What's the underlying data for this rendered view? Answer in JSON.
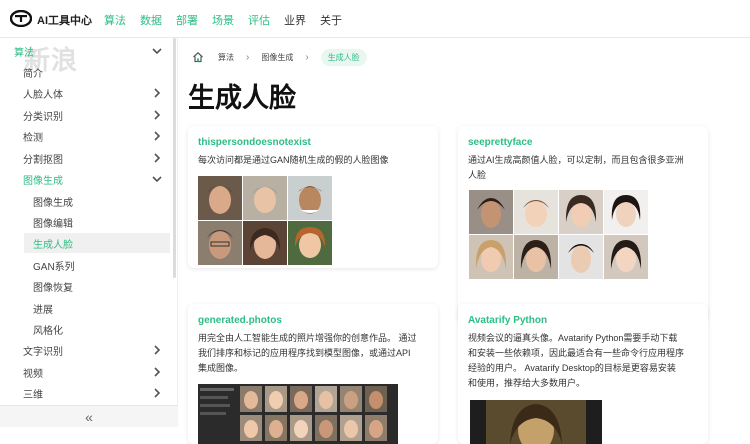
{
  "nav": {
    "brand": "AI工具中心",
    "links": [
      {
        "label": "算法",
        "active": true
      },
      {
        "label": "数据",
        "active": true
      },
      {
        "label": "部署",
        "active": true
      },
      {
        "label": "场景",
        "active": true
      },
      {
        "label": "评估",
        "active": true
      },
      {
        "label": "业界",
        "active": false
      },
      {
        "label": "关于",
        "active": false
      }
    ]
  },
  "sidebar": {
    "section_label": "算法",
    "watermark": "新浪",
    "items": [
      {
        "label": "简介"
      },
      {
        "label": "人脸人体"
      },
      {
        "label": "分类识别"
      },
      {
        "label": "检测"
      },
      {
        "label": "分割抠图"
      },
      {
        "label": "图像生成"
      },
      {
        "label": "图像生成"
      },
      {
        "label": "图像编辑"
      },
      {
        "label": "生成人脸"
      },
      {
        "label": "GAN系列"
      },
      {
        "label": "图像恢复"
      },
      {
        "label": "进展"
      },
      {
        "label": "风格化"
      },
      {
        "label": "文字识别"
      },
      {
        "label": "视频"
      },
      {
        "label": "三维"
      }
    ],
    "collapse_label": "«"
  },
  "breadcrumb": {
    "level1": "算法",
    "level2": "图像生成",
    "current": "生成人脸"
  },
  "page_title": "生成人脸",
  "cards": [
    {
      "title": "thispersondoesnotexist",
      "desc": "每次访问都是通过GAN随机生成的假的人脸图像"
    },
    {
      "title": "seeprettyface",
      "desc_line1": "通过AI生成高颜值人脸，可以定制，而且包含很多亚洲",
      "desc_line2": "人脸"
    },
    {
      "title": "generated.photos",
      "desc_line1": "用完全由人工智能生成的照片增强你的创意作品。 通过",
      "desc_line2": "我们排序和标记的应用程序找到模型图像，或通过API",
      "desc_line3": "集成图像。"
    },
    {
      "title": "Avatarify Python",
      "desc_line1": "视频会议的逼真头像。Avatarify Python需要手动下载",
      "desc_line2": "和安装一些依赖项，因此最适合有一些命令行应用程序",
      "desc_line3": "经验的用户。 Avatarify Desktop的目标是更容易安装",
      "desc_line4": "和使用，推荐给大多数用户。"
    }
  ],
  "colors": {
    "accent": "#2ebd85",
    "selected_bg": "#f0f0f0"
  }
}
